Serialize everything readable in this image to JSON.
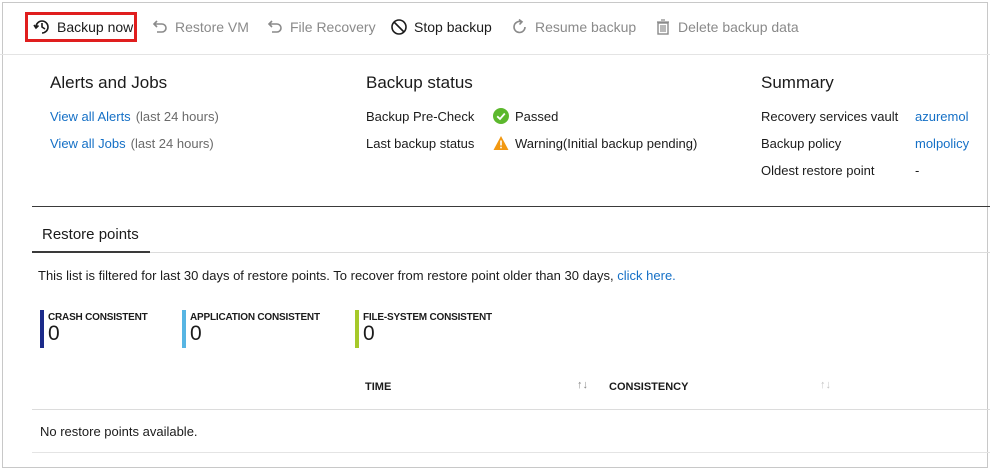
{
  "toolbar": {
    "backup_now": "Backup now",
    "restore_vm": "Restore VM",
    "file_recovery": "File Recovery",
    "stop_backup": "Stop backup",
    "resume_backup": "Resume backup",
    "delete_backup_data": "Delete backup data"
  },
  "alerts_jobs": {
    "title": "Alerts and Jobs",
    "alerts_link": "View all Alerts",
    "alerts_note": "(last 24 hours)",
    "jobs_link": "View all Jobs",
    "jobs_note": "(last 24 hours)"
  },
  "backup_status": {
    "title": "Backup status",
    "precheck_label": "Backup Pre-Check",
    "precheck_value": "Passed",
    "last_label": "Last backup status",
    "last_value": "Warning(Initial backup pending)"
  },
  "summary": {
    "title": "Summary",
    "vault_label": "Recovery services vault",
    "vault_value": "azuremol",
    "policy_label": "Backup policy",
    "policy_value": "molpolicy",
    "oldest_label": "Oldest restore point",
    "oldest_value": "-"
  },
  "restore_points": {
    "tab": "Restore points",
    "filter_text": "This list is filtered for last 30 days of restore points. To recover from restore point older than 30 days,",
    "filter_link": "click here.",
    "counters": [
      {
        "label": "CRASH CONSISTENT",
        "value": "0",
        "color": "#1b2a8a"
      },
      {
        "label": "APPLICATION CONSISTENT",
        "value": "0",
        "color": "#57b5e3"
      },
      {
        "label": "FILE-SYSTEM CONSISTENT",
        "value": "0",
        "color": "#a6c92a"
      }
    ],
    "columns": [
      "TIME",
      "CONSISTENCY"
    ],
    "empty_message": "No restore points available."
  },
  "colors": {
    "highlight": "#e01e1e",
    "link": "#1570c6",
    "success": "#5cb82d",
    "warning": "#f29811"
  }
}
